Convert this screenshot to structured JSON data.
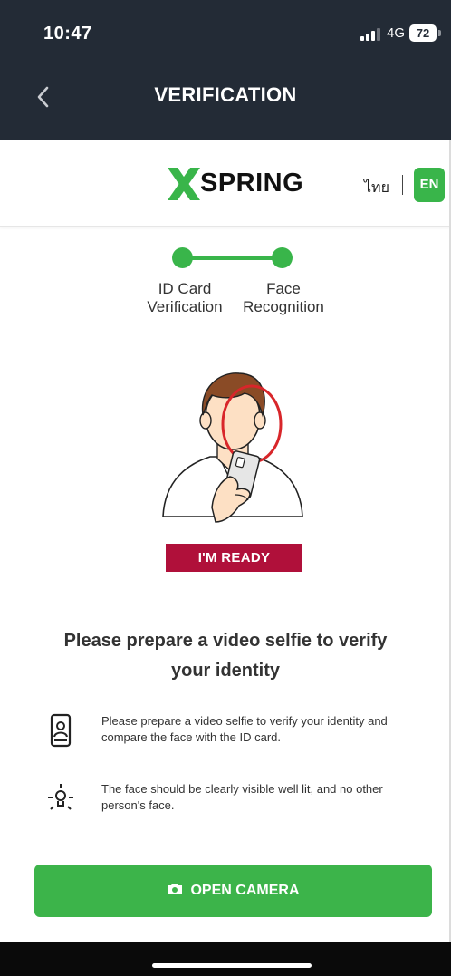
{
  "status_bar": {
    "time": "10:47",
    "network": "4G",
    "battery": "72"
  },
  "nav": {
    "title": "VERIFICATION",
    "back_icon": "chevron-left-icon"
  },
  "brand": {
    "logo_text": "SPRING",
    "lang_thai": "ไทย",
    "lang_en": "EN",
    "accent": "#39b54a"
  },
  "stepper": {
    "steps": [
      {
        "label_line1": "ID Card",
        "label_line2": "Verification"
      },
      {
        "label_line1": "Face",
        "label_line2": "Recognition"
      }
    ]
  },
  "illustration": {
    "badge_label": "I'M READY",
    "badge_color": "#b0103a"
  },
  "main": {
    "headline_line1": "Please prepare a video selfie to verify",
    "headline_line2": "your identity",
    "tips": [
      {
        "icon": "phone-selfie-icon",
        "text": "Please prepare a video selfie to verify your identity and compare the face with the ID card."
      },
      {
        "icon": "light-bulb-icon",
        "text": "The face should be clearly visible well lit, and no other person's face."
      }
    ]
  },
  "action": {
    "open_camera_label": "OPEN CAMERA",
    "icon": "camera-icon",
    "color": "#3cb44a"
  }
}
